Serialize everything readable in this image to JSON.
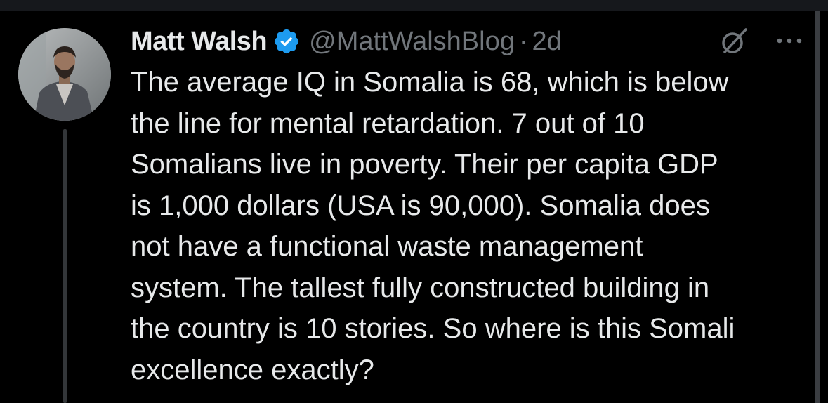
{
  "tweet": {
    "display_name": "Matt Walsh",
    "handle": "@MattWalshBlog",
    "separator": "·",
    "time": "2d",
    "verified": true,
    "text_lines": [
      "The average IQ in Somalia is 68, which is below",
      "the line for mental retardation. 7 out of 10",
      "Somalians live in poverty. Their per capita GDP",
      "is 1,000 dollars (USA is 90,000). Somalia does",
      "not have a functional waste management",
      "system. The tallest fully constructed building in",
      "the country is 10 stories. So where is this Somali",
      "excellence exactly?"
    ]
  },
  "icons": {
    "verified": "verified-badge-icon",
    "grok": "grok-icon",
    "more": "more-options-icon"
  },
  "colors": {
    "background": "#000000",
    "text": "#e7e9ea",
    "secondary_text": "#71767b",
    "verified_blue": "#1d9bf0",
    "thread_line": "#333639"
  }
}
